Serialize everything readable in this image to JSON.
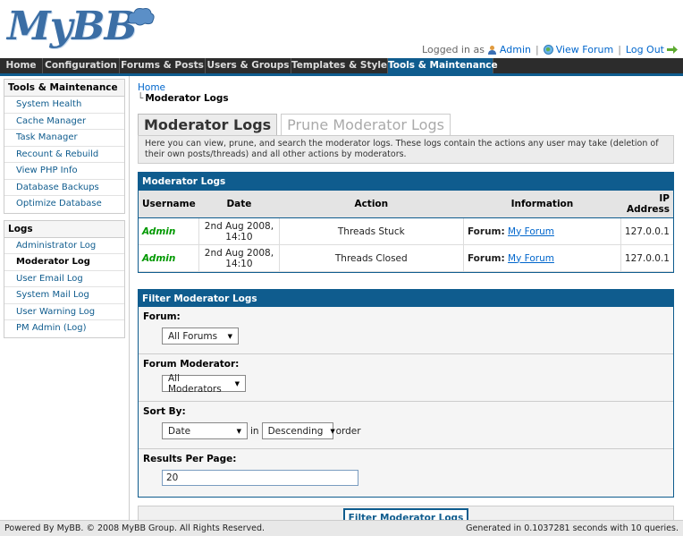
{
  "header": {
    "logo": "MyBB",
    "logged_in_prefix": "Logged in as",
    "user": "Admin",
    "view_forum": "View Forum",
    "logout": "Log Out"
  },
  "nav": {
    "tabs": [
      "Home",
      "Configuration",
      "Forums & Posts",
      "Users & Groups",
      "Templates & Style",
      "Tools & Maintenance"
    ],
    "active": "Tools & Maintenance"
  },
  "sidebar": {
    "sections": [
      {
        "title": "Tools & Maintenance",
        "items": [
          "System Health",
          "Cache Manager",
          "Task Manager",
          "Recount & Rebuild",
          "View PHP Info",
          "Database Backups",
          "Optimize Database"
        ]
      },
      {
        "title": "Logs",
        "items": [
          "Administrator Log",
          "Moderator Log",
          "User Email Log",
          "System Mail Log",
          "User Warning Log",
          "PM Admin (Log)"
        ]
      }
    ],
    "active_item": "Moderator Log"
  },
  "breadcrumb": {
    "home": "Home",
    "current": "Moderator Logs"
  },
  "page_tabs": {
    "active": "Moderator Logs",
    "inactive": "Prune Moderator Logs"
  },
  "description": "Here you can view, prune, and search the moderator logs. These logs contain the actions any user may take (deletion of their own posts/threads) and all other actions by moderators.",
  "logs_table": {
    "title": "Moderator Logs",
    "columns": [
      "Username",
      "Date",
      "Action",
      "Information",
      "IP Address"
    ],
    "rows": [
      {
        "username": "Admin",
        "date_line1": "2nd Aug 2008,",
        "date_line2": "14:10",
        "action": "Threads Stuck",
        "info_label": "Forum:",
        "info_link": "My Forum",
        "ip": "127.0.0.1"
      },
      {
        "username": "Admin",
        "date_line1": "2nd Aug 2008,",
        "date_line2": "14:10",
        "action": "Threads Closed",
        "info_label": "Forum:",
        "info_link": "My Forum",
        "ip": "127.0.0.1"
      }
    ]
  },
  "filter": {
    "title": "Filter Moderator Logs",
    "forum_label": "Forum:",
    "forum_value": "All Forums",
    "moderator_label": "Forum Moderator:",
    "moderator_value": "All Moderators",
    "sort_label": "Sort By:",
    "sort_value": "Date",
    "sort_in": "in",
    "order_value": "Descending",
    "order_word": "order",
    "per_page_label": "Results Per Page:",
    "per_page_value": "20",
    "submit": "Filter Moderator Logs"
  },
  "footer": {
    "left": "Powered By MyBB. © 2008 MyBB Group. All Rights Reserved.",
    "right": "Generated in 0.1037281 seconds with 10 queries."
  },
  "colors": {
    "accent": "#0f5c8e",
    "nav_bg": "#2c2c2c",
    "username": "#009900"
  }
}
